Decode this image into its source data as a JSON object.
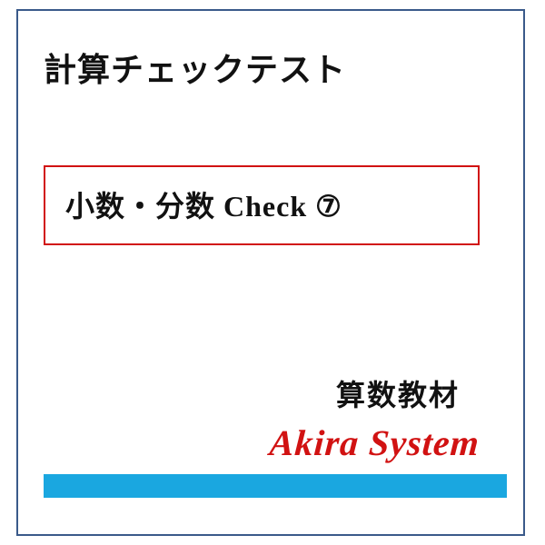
{
  "title": "計算チェックテスト",
  "check_box": {
    "label": "小数・分数 Check ⑦"
  },
  "subject": "算数教材",
  "brand": "Akira System",
  "colors": {
    "frame_border": "#3a5a8a",
    "box_border": "#d11212",
    "brand_color": "#d11212",
    "bar_color": "#1aa7e0"
  }
}
